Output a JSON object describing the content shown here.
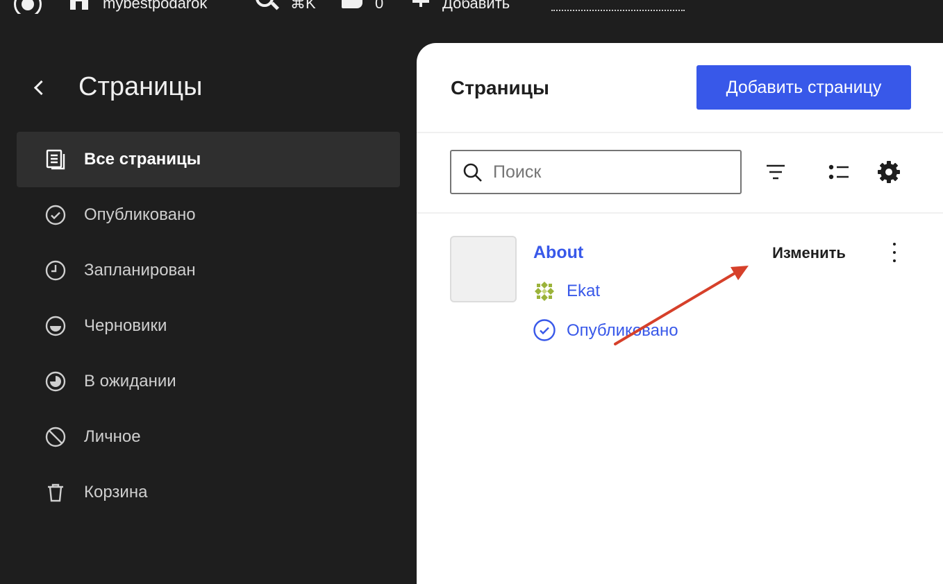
{
  "admin_bar": {
    "site_name": "mybestpodarok",
    "shortcut": "⌘K",
    "comment_count": "0",
    "new_label": "Добавить"
  },
  "sidebar": {
    "title": "Страницы",
    "items": [
      {
        "label": "Все страницы",
        "icon": "pages-icon",
        "active": true
      },
      {
        "label": "Опубликовано",
        "icon": "published-check-icon"
      },
      {
        "label": "Запланирован",
        "icon": "scheduled-clock-icon"
      },
      {
        "label": "Черновики",
        "icon": "draft-half-circle-icon"
      },
      {
        "label": "В ожидании",
        "icon": "pending-pie-icon"
      },
      {
        "label": "Личное",
        "icon": "private-block-icon"
      },
      {
        "label": "Корзина",
        "icon": "trash-icon"
      }
    ]
  },
  "main": {
    "title": "Страницы",
    "add_button": "Добавить страницу",
    "search": {
      "placeholder": "Поиск",
      "value": ""
    },
    "row": {
      "title": "About",
      "author": "Ekat",
      "status": "Опубликовано",
      "edit_label": "Изменить"
    }
  },
  "colors": {
    "accent": "#3858e9",
    "sidebar_bg": "#1e1e1e",
    "annotation_arrow": "#d6402a"
  }
}
